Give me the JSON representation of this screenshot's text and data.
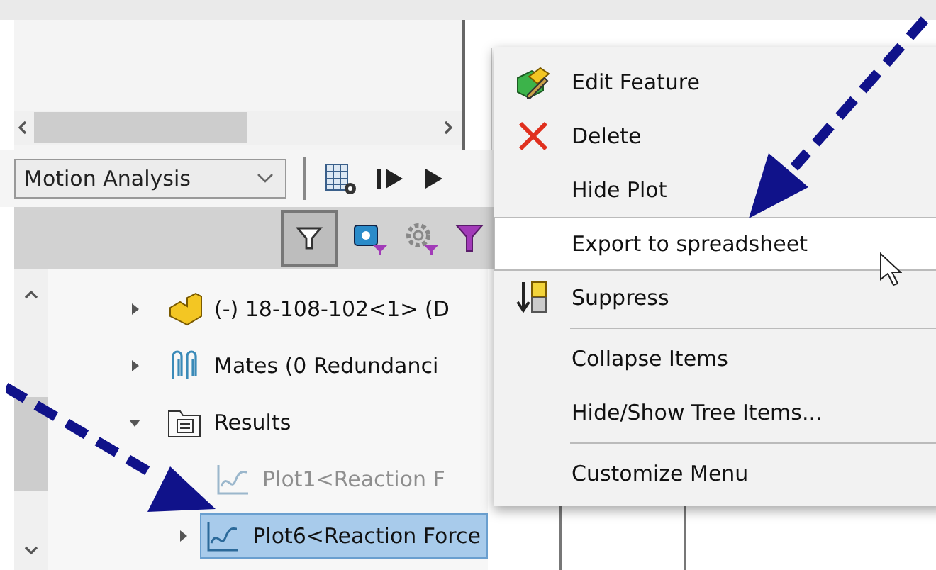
{
  "study_dropdown": {
    "value": "Motion Analysis"
  },
  "tree": {
    "items": [
      {
        "label": "(-) 18-108-102<1> (D",
        "kind": "part",
        "expanded": false,
        "selected": false,
        "hidden": false
      },
      {
        "label": "Mates (0 Redundanci",
        "kind": "mates",
        "expanded": false,
        "selected": false,
        "hidden": false
      },
      {
        "label": "Results",
        "kind": "folder",
        "expanded": true,
        "selected": false,
        "hidden": false,
        "children": [
          {
            "label": "Plot1<Reaction F",
            "kind": "plot",
            "selected": false,
            "hidden": true
          },
          {
            "label": "Plot6<Reaction Force",
            "kind": "plot",
            "expanded": false,
            "selected": true,
            "hidden": false
          }
        ]
      }
    ]
  },
  "context_menu": {
    "items": [
      {
        "kind": "edit",
        "label": "Edit Feature",
        "selected": false
      },
      {
        "kind": "delete",
        "label": "Delete",
        "selected": false
      },
      {
        "kind": "plain",
        "label": "Hide Plot",
        "selected": false
      },
      {
        "kind": "plain",
        "label": "Export to spreadsheet",
        "selected": true
      },
      {
        "kind": "suppress",
        "label": "Suppress",
        "selected": false
      },
      {
        "kind": "separator"
      },
      {
        "kind": "plain",
        "label": "Collapse Items",
        "selected": false
      },
      {
        "kind": "plain",
        "label": "Hide/Show Tree Items...",
        "selected": false
      },
      {
        "kind": "separator"
      },
      {
        "kind": "plain",
        "label": "Customize Menu",
        "selected": false
      }
    ]
  }
}
